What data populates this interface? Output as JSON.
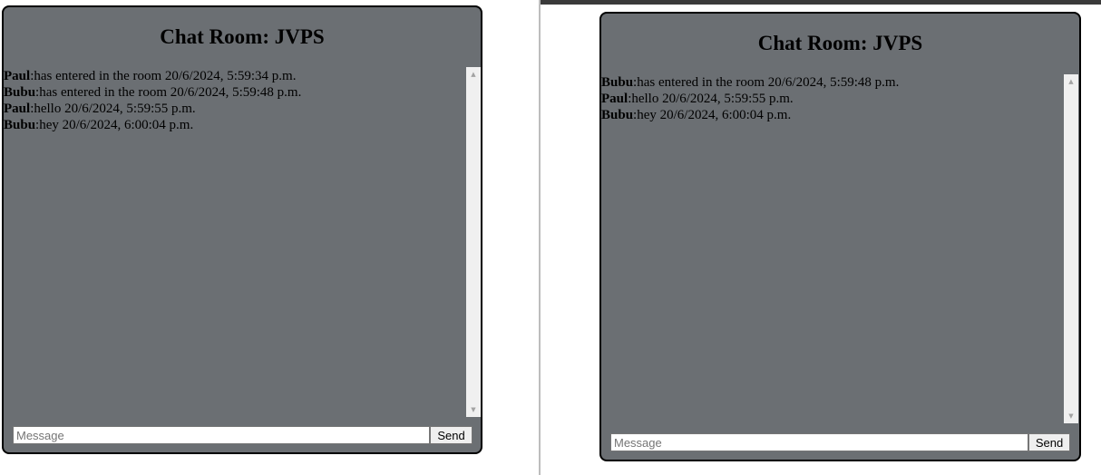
{
  "windows": [
    {
      "title": "Chat Room: JVPS",
      "messages": [
        {
          "user": "Paul",
          "text": ":has entered in the room 20/6/2024, 5:59:34 p.m."
        },
        {
          "user": "Bubu",
          "text": ":has entered in the room 20/6/2024, 5:59:48 p.m."
        },
        {
          "user": "Paul",
          "text": ":hello 20/6/2024, 5:59:55 p.m."
        },
        {
          "user": "Bubu",
          "text": ":hey 20/6/2024, 6:00:04 p.m."
        }
      ],
      "input_placeholder": "Message",
      "send_label": "Send"
    },
    {
      "title": "Chat Room: JVPS",
      "messages": [
        {
          "user": "Bubu",
          "text": ":has entered in the room 20/6/2024, 5:59:48 p.m."
        },
        {
          "user": "Paul",
          "text": ":hello 20/6/2024, 5:59:55 p.m."
        },
        {
          "user": "Bubu",
          "text": ":hey 20/6/2024, 6:00:04 p.m."
        }
      ],
      "input_placeholder": "Message",
      "send_label": "Send"
    }
  ],
  "colors": {
    "chat_background": "#6b6f73",
    "border": "#000000",
    "scrollbar_track": "#f0f0f0",
    "top_bar": "#3a3a3a"
  },
  "icons": {
    "scroll_up": "scroll-up-arrow-icon",
    "scroll_down": "scroll-down-arrow-icon"
  }
}
